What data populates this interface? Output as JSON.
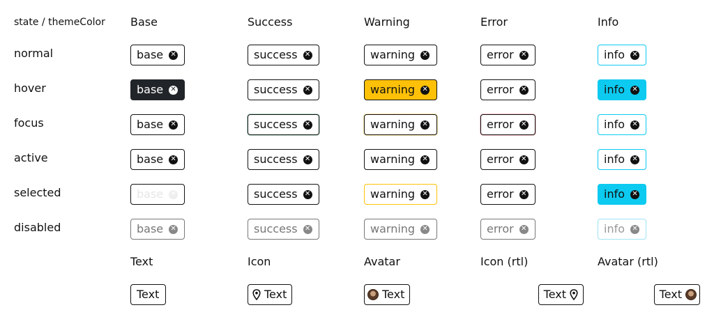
{
  "corner_label": "state / themeColor",
  "columns": [
    "Base",
    "Success",
    "Warning",
    "Error",
    "Info"
  ],
  "states": [
    "normal",
    "hover",
    "focus",
    "active",
    "selected",
    "disabled"
  ],
  "chip_labels": [
    "base",
    "success",
    "warning",
    "error",
    "info"
  ],
  "clear_icon_glyph": "✕",
  "colors": {
    "border": "#111111",
    "hover_base_bg": "#212529",
    "warning_bg": "#ffc107",
    "info_bg": "#0dcaf0",
    "info_border": "#0dcaf0",
    "disabled_text": "#777777"
  },
  "variants": {
    "headers": [
      "Text",
      "Icon",
      "Avatar",
      "Icon (rtl)",
      "Avatar (rtl)"
    ],
    "chip_text": "Text",
    "icons": [
      "location-pin-icon",
      "avatar-image"
    ]
  }
}
